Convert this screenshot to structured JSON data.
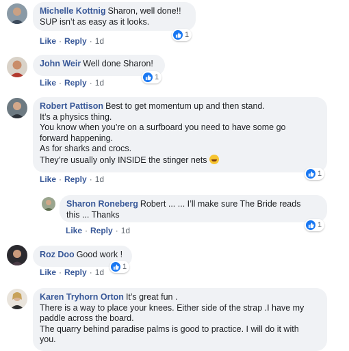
{
  "comments": [
    {
      "author": "Michelle Kottnig",
      "lines": [
        "Sharon, well done!!",
        "SUP isn’t as easy as it looks."
      ],
      "actions": {
        "like": "Like",
        "reply": "Reply",
        "time": "1d"
      },
      "reactions": "1"
    },
    {
      "author": "John Weir",
      "lines": [
        "Well done Sharon!"
      ],
      "actions": {
        "like": "Like",
        "reply": "Reply",
        "time": "1d"
      },
      "reactions": "1"
    },
    {
      "author": "Robert Pattison",
      "lines": [
        "Best to get momentum up and then stand.",
        "It’s a physics thing.",
        "You know when you’re on a surfboard you need to have some go",
        "forward happening.",
        "As for sharks and crocs.",
        "They’re usually only INSIDE the stinger nets"
      ],
      "emoji": "rolling-on-floor-laughing-emoji",
      "actions": {
        "like": "Like",
        "reply": "Reply",
        "time": "1d"
      },
      "reactions": "1"
    },
    {
      "author": "Sharon Roneberg",
      "lines": [
        "Robert ... ... I’ll make sure The Bride reads",
        "this ... Thanks"
      ],
      "actions": {
        "like": "Like",
        "reply": "Reply",
        "time": "1d"
      },
      "reactions": "1"
    },
    {
      "author": "Roz Doo",
      "lines": [
        "Good work !"
      ],
      "actions": {
        "like": "Like",
        "reply": "Reply",
        "time": "1d"
      },
      "reactions": "1"
    },
    {
      "author": "Karen Tryhorn Orton",
      "lines": [
        "It’s great fun .",
        "There is a way to place your knees. Either side of the strap .I have my",
        "paddle across the board.",
        "The quarry behind paradise palms is good to practice. I will do it with",
        "you."
      ]
    }
  ],
  "colors": {
    "link": "#385898",
    "bubble": "#f0f2f5",
    "like_blue": "#1877f2",
    "meta_gray": "#606770"
  }
}
